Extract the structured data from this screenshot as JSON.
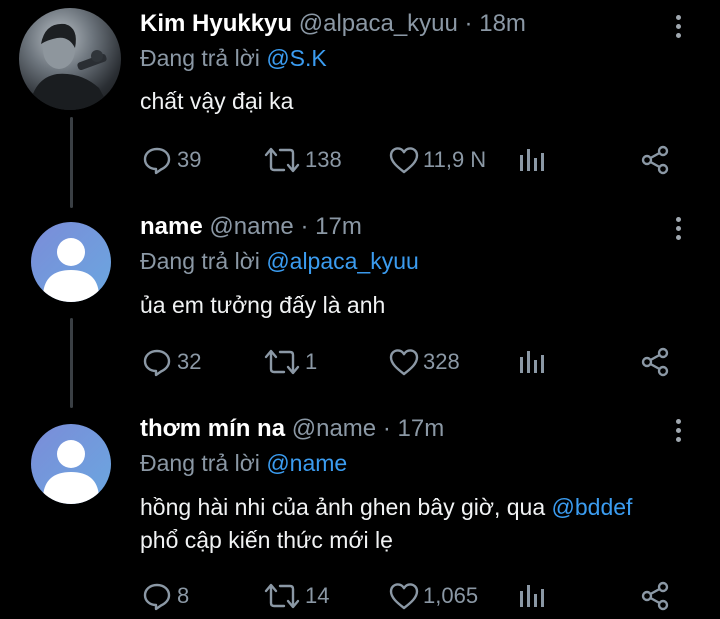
{
  "tweets": [
    {
      "name": "Kim Hyukkyu",
      "handle": "@alpaca_kyuu",
      "sep": "·",
      "time": "18m",
      "replying_prefix": "Đang trả lời",
      "replying_to": "@S.K",
      "text_line1": "chất vậy đại ka",
      "text_mention": "",
      "text_line2": "",
      "replies": "39",
      "retweets": "138",
      "likes": "11,9 N",
      "avatar": "profile-photo"
    },
    {
      "name": "name",
      "handle": "@name",
      "sep": "·",
      "time": "17m",
      "replying_prefix": "Đang trả lời",
      "replying_to": "@alpaca_kyuu",
      "text_line1": "ủa em tưởng đấy là anh",
      "text_mention": "",
      "text_line2": "",
      "replies": "32",
      "retweets": "1",
      "likes": "328",
      "avatar": "default-avatar"
    },
    {
      "name": "thơm mín na",
      "handle": "@name",
      "sep": "·",
      "time": "17m",
      "replying_prefix": "Đang trả lời",
      "replying_to": "@name",
      "text_line1": "hồng hài nhi của ảnh ghen bây giờ, qua ",
      "text_mention": "@bddef",
      "text_line2": "phổ cập kiến thức mới lẹ",
      "replies": "8",
      "retweets": "14",
      "likes": "1,065",
      "avatar": "default-avatar"
    }
  ],
  "icons": {
    "reply": "reply-icon",
    "retweet": "retweet-icon",
    "like": "heart-icon",
    "views": "analytics-icon",
    "share": "share-icon",
    "more": "more-vertical-icon"
  },
  "colors": {
    "background": "#000000",
    "text": "#e7e9ea",
    "muted": "#8b98a5",
    "link": "#3b9cf0"
  }
}
